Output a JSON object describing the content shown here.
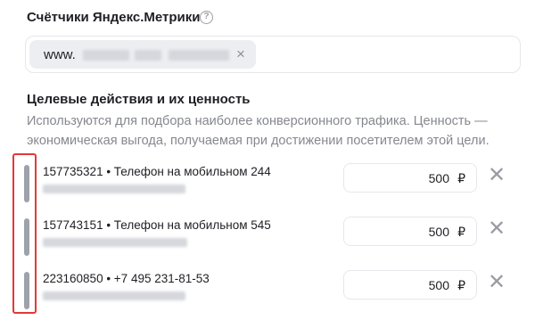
{
  "counters": {
    "title": "Счётчики Яндекс.Метрики",
    "help_icon": "?",
    "chip_prefix": "www.",
    "chip_close": "×"
  },
  "goals": {
    "title": "Целевые действия и их ценность",
    "description": "Используются для подбора наиболее конверсионного трафика. Ценность — экономическая выгода, получаемая при достижении посетителем этой цели.",
    "items": [
      {
        "name": "157735321 • Телефон на мобильном 244",
        "price": "500",
        "currency": "₽"
      },
      {
        "name": "157743151 • Телефон на мобильном 545",
        "price": "500",
        "currency": "₽"
      },
      {
        "name": "223160850 • +7 495 231-81-53",
        "price": "500",
        "currency": "₽"
      }
    ],
    "remove_glyph": "✕"
  },
  "colors": {
    "highlight": "#e33838",
    "handle": "#9ea2ab"
  }
}
